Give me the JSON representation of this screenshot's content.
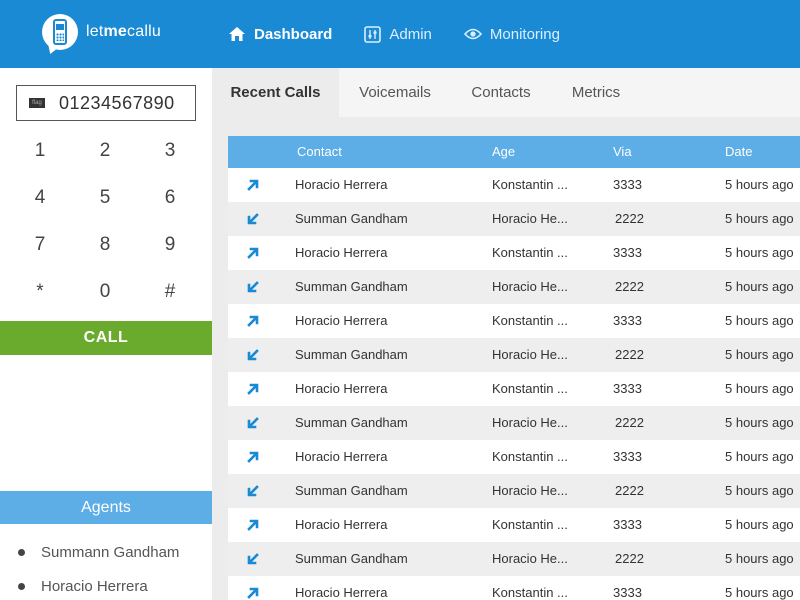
{
  "brand": {
    "logo_prefix": "let",
    "logo_bold": "me",
    "logo_suffix": "callu"
  },
  "nav": [
    {
      "label": "Dashboard",
      "icon": "home-icon",
      "active": true
    },
    {
      "label": "Admin",
      "icon": "sliders-icon",
      "active": false
    },
    {
      "label": "Monitoring",
      "icon": "eye-icon",
      "active": false
    }
  ],
  "dialer": {
    "flag_label": "flag",
    "number": "01234567890",
    "keys": [
      "1",
      "2",
      "3",
      "4",
      "5",
      "6",
      "7",
      "8",
      "9",
      "*",
      "0",
      "#"
    ],
    "call_label": "CALL"
  },
  "agents": {
    "title": "Agents",
    "items": [
      "Summann Gandham",
      "Horacio Herrera"
    ]
  },
  "tabs": [
    "Recent Calls",
    "Voicemails",
    "Contacts",
    "Metrics"
  ],
  "table": {
    "columns": [
      "Contact",
      "Age",
      "Via",
      "Date"
    ],
    "rows": [
      {
        "direction": "outgoing",
        "contact": "Horacio Herrera",
        "age": "Konstantin ...",
        "via": "3333",
        "date": "5 hours ago"
      },
      {
        "direction": "incoming",
        "contact": "Summan Gandham",
        "age": "Horacio He...",
        "via": "2222",
        "date": "5 hours ago"
      },
      {
        "direction": "outgoing",
        "contact": "Horacio Herrera",
        "age": "Konstantin ...",
        "via": "3333",
        "date": "5 hours ago"
      },
      {
        "direction": "incoming",
        "contact": "Summan Gandham",
        "age": "Horacio He...",
        "via": "2222",
        "date": "5 hours ago"
      },
      {
        "direction": "outgoing",
        "contact": "Horacio Herrera",
        "age": "Konstantin ...",
        "via": "3333",
        "date": "5 hours ago"
      },
      {
        "direction": "incoming",
        "contact": "Summan Gandham",
        "age": "Horacio He...",
        "via": "2222",
        "date": "5 hours ago"
      },
      {
        "direction": "outgoing",
        "contact": "Horacio Herrera",
        "age": "Konstantin ...",
        "via": "3333",
        "date": "5 hours ago"
      },
      {
        "direction": "incoming",
        "contact": "Summan Gandham",
        "age": "Horacio He...",
        "via": "2222",
        "date": "5 hours ago"
      },
      {
        "direction": "outgoing",
        "contact": "Horacio Herrera",
        "age": "Konstantin ...",
        "via": "3333",
        "date": "5 hours ago"
      },
      {
        "direction": "incoming",
        "contact": "Summan Gandham",
        "age": "Horacio He...",
        "via": "2222",
        "date": "5 hours ago"
      },
      {
        "direction": "outgoing",
        "contact": "Horacio Herrera",
        "age": "Konstantin ...",
        "via": "3333",
        "date": "5 hours ago"
      },
      {
        "direction": "incoming",
        "contact": "Summan Gandham",
        "age": "Horacio He...",
        "via": "2222",
        "date": "5 hours ago"
      },
      {
        "direction": "outgoing",
        "contact": "Horacio Herrera",
        "age": "Konstantin ...",
        "via": "3333",
        "date": "5 hours ago"
      }
    ]
  },
  "colors": {
    "primary": "#1a8ad4",
    "accent": "#5dade6",
    "call": "#6aab2e",
    "arrow": "#1a8ad4"
  }
}
